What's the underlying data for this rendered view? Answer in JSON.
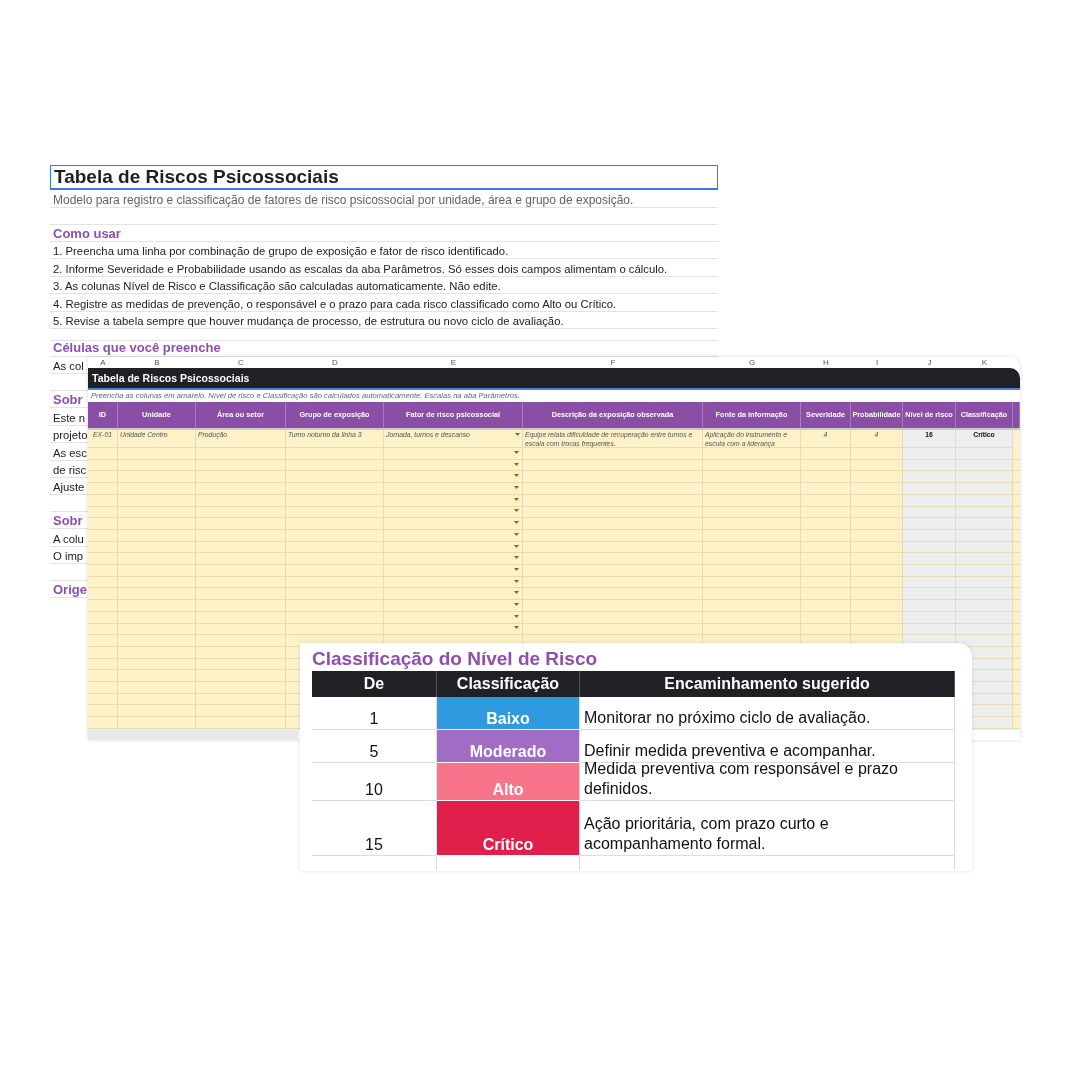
{
  "back_sheet": {
    "title": "Tabela de Riscos Psicossociais",
    "title_selected": true,
    "subtitle": "Modelo para registro e classificação de fatores de risco psicossocial por unidade, área e grupo de exposição.",
    "sections": [
      {
        "heading": "Como usar",
        "lines": [
          "1. Preencha uma linha por combinação de grupo de exposição e fator de risco identificado.",
          "2. Informe Severidade e Probabilidade usando as escalas da aba Parâmetros. Só esses dois campos alimentam o cálculo.",
          "3. As colunas Nível de Risco e Classificação são calculadas automaticamente. Não edite.",
          "4. Registre as medidas de prevenção, o responsável e o prazo para cada risco classificado como Alto ou Crítico.",
          "5. Revise a tabela sempre que houver mudança de processo, de estrutura ou novo ciclo de avaliação."
        ]
      },
      {
        "heading": "Células que você preenche",
        "lines": [
          "As col"
        ]
      },
      {
        "heading": "Sobr",
        "lines": [
          "Este n",
          "projeto",
          "As esc",
          "de risc",
          "Ajuste"
        ]
      },
      {
        "heading": "Sobr",
        "lines": [
          "A colu",
          "O imp"
        ]
      },
      {
        "heading": "Orige"
      }
    ]
  },
  "risk_sheet": {
    "column_letters": [
      "A",
      "B",
      "C",
      "D",
      "E",
      "F",
      "G",
      "H",
      "I",
      "J",
      "K"
    ],
    "title": "Tabela de Riscos Psicossociais",
    "note": "Preencha as colunas em amarelo. Nível de risco e Classificação são calculados automaticamente. Escalas na aba Parâmetros.",
    "columns": [
      {
        "label": "ID",
        "kind": "input"
      },
      {
        "label": "Unidade",
        "kind": "input"
      },
      {
        "label": "Área ou setor",
        "kind": "input"
      },
      {
        "label": "Grupo de exposição",
        "kind": "input"
      },
      {
        "label": "Fator de risco psicossocial",
        "kind": "input"
      },
      {
        "label": "Descrição da exposição observada",
        "kind": "input"
      },
      {
        "label": "Fonte da informação",
        "kind": "input"
      },
      {
        "label": "Severidade",
        "kind": "input"
      },
      {
        "label": "Probabilidade",
        "kind": "input"
      },
      {
        "label": "Nível de risco",
        "kind": "calculated"
      },
      {
        "label": "Classificação",
        "kind": "calculated"
      }
    ],
    "rows": [
      {
        "cells": [
          "EX-01",
          "Unidade Centro",
          "Produção",
          "Turno noturno da linha 3",
          "Jornada, turnos e descanso",
          "Equipe relata dificuldade de recuperação entre turnos e escala com trocas frequentes.",
          "Aplicação do instrumento e escuta com a liderança",
          "4",
          "4",
          "16",
          "Crítico"
        ],
        "dropdown": true
      },
      {
        "dropdown": true
      },
      {
        "dropdown": true
      },
      {
        "dropdown": true
      },
      {
        "dropdown": true
      },
      {
        "dropdown": true
      },
      {
        "dropdown": true
      },
      {
        "dropdown": true
      },
      {
        "dropdown": true
      },
      {
        "dropdown": true
      },
      {
        "dropdown": true
      },
      {
        "dropdown": true
      },
      {
        "dropdown": true
      },
      {
        "dropdown": true
      },
      {
        "dropdown": true
      },
      {
        "dropdown": true
      },
      {
        "dropdown": true
      }
    ]
  },
  "legend": {
    "title": "Classificação do Nível de Risco",
    "columns": [
      "De",
      "Classificação",
      "Encaminhamento sugerido"
    ],
    "rows": [
      {
        "from": "1",
        "level": "Baixo",
        "color": "#2f9ae0",
        "action": "Monitorar no próximo ciclo de avaliação."
      },
      {
        "from": "5",
        "level": "Moderado",
        "color": "#a06cc4",
        "action": "Definir medida preventiva e acompanhar."
      },
      {
        "from": "10",
        "level": "Alto",
        "color": "#f8748a",
        "action": "Medida preventiva com responsável e prazo definidos."
      },
      {
        "from": "15",
        "level": "Crítico",
        "color": "#e01f4b",
        "action": "Ação prioritária, com prazo curto e acompanhamento formal."
      }
    ]
  }
}
